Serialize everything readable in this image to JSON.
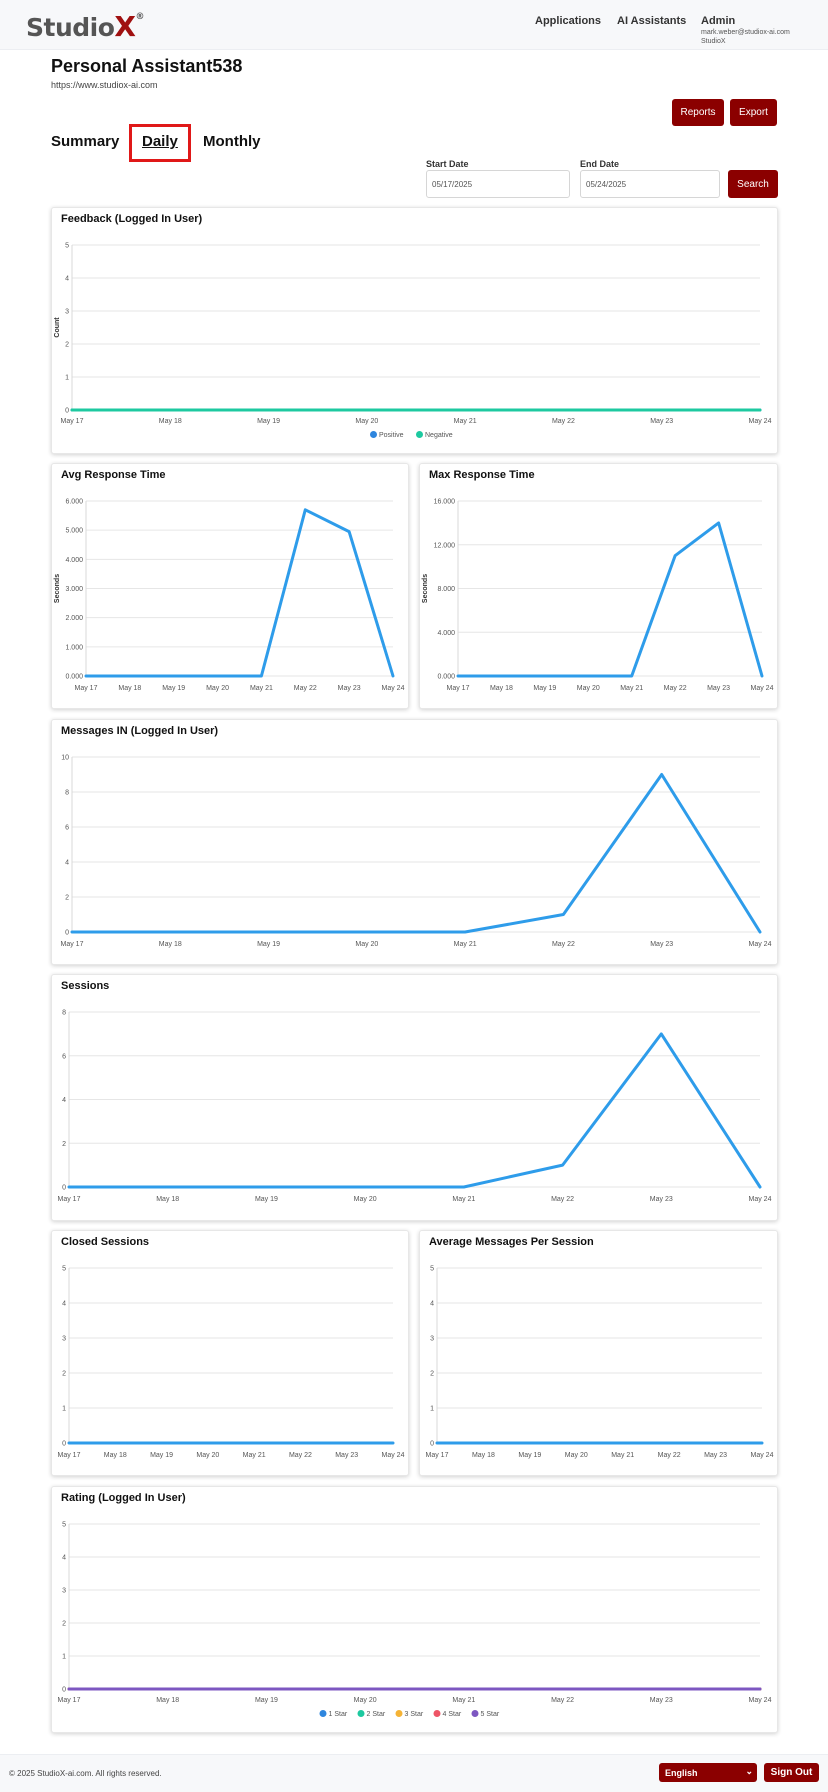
{
  "header": {
    "logo_text": "Studio",
    "logo_x": "X",
    "logo_mark": "®",
    "nav": {
      "applications": "Applications",
      "assistants": "AI Assistants"
    },
    "user": {
      "name": "Admin",
      "email": "mark.weber@studiox-ai.com",
      "org": "StudioX"
    }
  },
  "page": {
    "title": "Personal Assistant538",
    "url": "https://www.studiox-ai.com"
  },
  "actions": {
    "reports": "Reports",
    "export": "Export",
    "search": "Search"
  },
  "tabs": [
    {
      "label": "Summary",
      "active": false
    },
    {
      "label": "Daily",
      "active": true
    },
    {
      "label": "Monthly",
      "active": false
    }
  ],
  "filters": {
    "start_label": "Start Date",
    "start_value": "05/17/2025",
    "end_label": "End Date",
    "end_value": "05/24/2025"
  },
  "colors": {
    "accent": "#8b0000",
    "highlight": "#e01818",
    "line_blue": "#2e9cea",
    "positive": "#2e86de",
    "negative": "#1dc9a0"
  },
  "chart_data": [
    {
      "id": "feedback",
      "type": "line",
      "title": "Feedback (Logged In User)",
      "ylabel": "Count",
      "ylim": [
        0,
        5
      ],
      "yticks": [
        "0",
        "1",
        "2",
        "3",
        "4",
        "5"
      ],
      "categories": [
        "May 17",
        "May 18",
        "May 19",
        "May 20",
        "May 21",
        "May 22",
        "May 23",
        "May 24"
      ],
      "series": [
        {
          "name": "Positive",
          "color": "#2e86de",
          "values": [
            0,
            0,
            0,
            0,
            0,
            0,
            0,
            0
          ]
        },
        {
          "name": "Negative",
          "color": "#1dc9a0",
          "values": [
            0,
            0,
            0,
            0,
            0,
            0,
            0,
            0
          ]
        }
      ],
      "legend": "bottom",
      "grid": true
    },
    {
      "id": "avg_response",
      "type": "line",
      "title": "Avg Response Time",
      "ylabel": "Seconds",
      "ylim": [
        0,
        6
      ],
      "yticks": [
        "0.000",
        "1.000",
        "2.000",
        "3.000",
        "4.000",
        "5.000",
        "6.000"
      ],
      "categories": [
        "May 17",
        "May 18",
        "May 19",
        "May 20",
        "May 21",
        "May 22",
        "May 23",
        "May 24"
      ],
      "series": [
        {
          "color": "#2e9cea",
          "values": [
            0,
            0,
            0,
            0,
            0,
            5.7,
            4.95,
            0
          ]
        }
      ],
      "grid": true
    },
    {
      "id": "max_response",
      "type": "line",
      "title": "Max Response Time",
      "ylabel": "Seconds",
      "ylim": [
        0,
        16
      ],
      "yticks": [
        "0.000",
        "4.000",
        "8.000",
        "12.000",
        "16.000"
      ],
      "categories": [
        "May 17",
        "May 18",
        "May 19",
        "May 20",
        "May 21",
        "May 22",
        "May 23",
        "May 24"
      ],
      "series": [
        {
          "color": "#2e9cea",
          "values": [
            0,
            0,
            0,
            0,
            0,
            11,
            14,
            0
          ]
        }
      ],
      "grid": true
    },
    {
      "id": "messages_in",
      "type": "line",
      "title": "Messages IN (Logged In User)",
      "ylim": [
        0,
        10
      ],
      "yticks": [
        "0",
        "2",
        "4",
        "6",
        "8",
        "10"
      ],
      "categories": [
        "May 17",
        "May 18",
        "May 19",
        "May 20",
        "May 21",
        "May 22",
        "May 23",
        "May 24"
      ],
      "series": [
        {
          "color": "#2e9cea",
          "values": [
            0,
            0,
            0,
            0,
            0,
            1,
            9,
            0
          ]
        }
      ],
      "grid": true
    },
    {
      "id": "sessions",
      "type": "line",
      "title": "Sessions",
      "ylim": [
        0,
        8
      ],
      "yticks": [
        "0",
        "2",
        "4",
        "6",
        "8"
      ],
      "categories": [
        "May 17",
        "May 18",
        "May 19",
        "May 20",
        "May 21",
        "May 22",
        "May 23",
        "May 24"
      ],
      "series": [
        {
          "color": "#2e9cea",
          "values": [
            0,
            0,
            0,
            0,
            0,
            1,
            7,
            0
          ]
        }
      ],
      "grid": true
    },
    {
      "id": "closed_sessions",
      "type": "line",
      "title": "Closed Sessions",
      "ylim": [
        0,
        5
      ],
      "yticks": [
        "0",
        "1",
        "2",
        "3",
        "4",
        "5"
      ],
      "categories": [
        "May 17",
        "May 18",
        "May 19",
        "May 20",
        "May 21",
        "May 22",
        "May 23",
        "May 24"
      ],
      "series": [
        {
          "color": "#2e9cea",
          "values": [
            0,
            0,
            0,
            0,
            0,
            0,
            0,
            0
          ]
        }
      ],
      "grid": true
    },
    {
      "id": "avg_messages",
      "type": "line",
      "title": "Average Messages Per Session",
      "ylim": [
        0,
        5
      ],
      "yticks": [
        "0",
        "1",
        "2",
        "3",
        "4",
        "5"
      ],
      "categories": [
        "May 17",
        "May 18",
        "May 19",
        "May 20",
        "May 21",
        "May 22",
        "May 23",
        "May 24"
      ],
      "series": [
        {
          "color": "#2e9cea",
          "values": [
            0,
            0,
            0,
            0,
            0,
            0,
            0,
            0
          ]
        }
      ],
      "grid": true
    },
    {
      "id": "rating",
      "type": "line",
      "title": "Rating (Logged In User)",
      "ylim": [
        0,
        5
      ],
      "yticks": [
        "0",
        "1",
        "2",
        "3",
        "4",
        "5"
      ],
      "categories": [
        "May 17",
        "May 18",
        "May 19",
        "May 20",
        "May 21",
        "May 22",
        "May 23",
        "May 24"
      ],
      "series": [
        {
          "name": "1 Star",
          "color": "#2e86de",
          "values": [
            0,
            0,
            0,
            0,
            0,
            0,
            0,
            0
          ]
        },
        {
          "name": "2 Star",
          "color": "#1dc9a0",
          "values": [
            0,
            0,
            0,
            0,
            0,
            0,
            0,
            0
          ]
        },
        {
          "name": "3 Star",
          "color": "#f5b335",
          "values": [
            0,
            0,
            0,
            0,
            0,
            0,
            0,
            0
          ]
        },
        {
          "name": "4 Star",
          "color": "#ee5566",
          "values": [
            0,
            0,
            0,
            0,
            0,
            0,
            0,
            0
          ]
        },
        {
          "name": "5 Star",
          "color": "#7d57c1",
          "values": [
            0,
            0,
            0,
            0,
            0,
            0,
            0,
            0
          ]
        }
      ],
      "legend": "bottom",
      "grid": true
    }
  ],
  "footer": {
    "copyright": "© 2025 StudioX-ai.com.  All rights reserved.",
    "language": "English",
    "signout": "Sign Out"
  }
}
